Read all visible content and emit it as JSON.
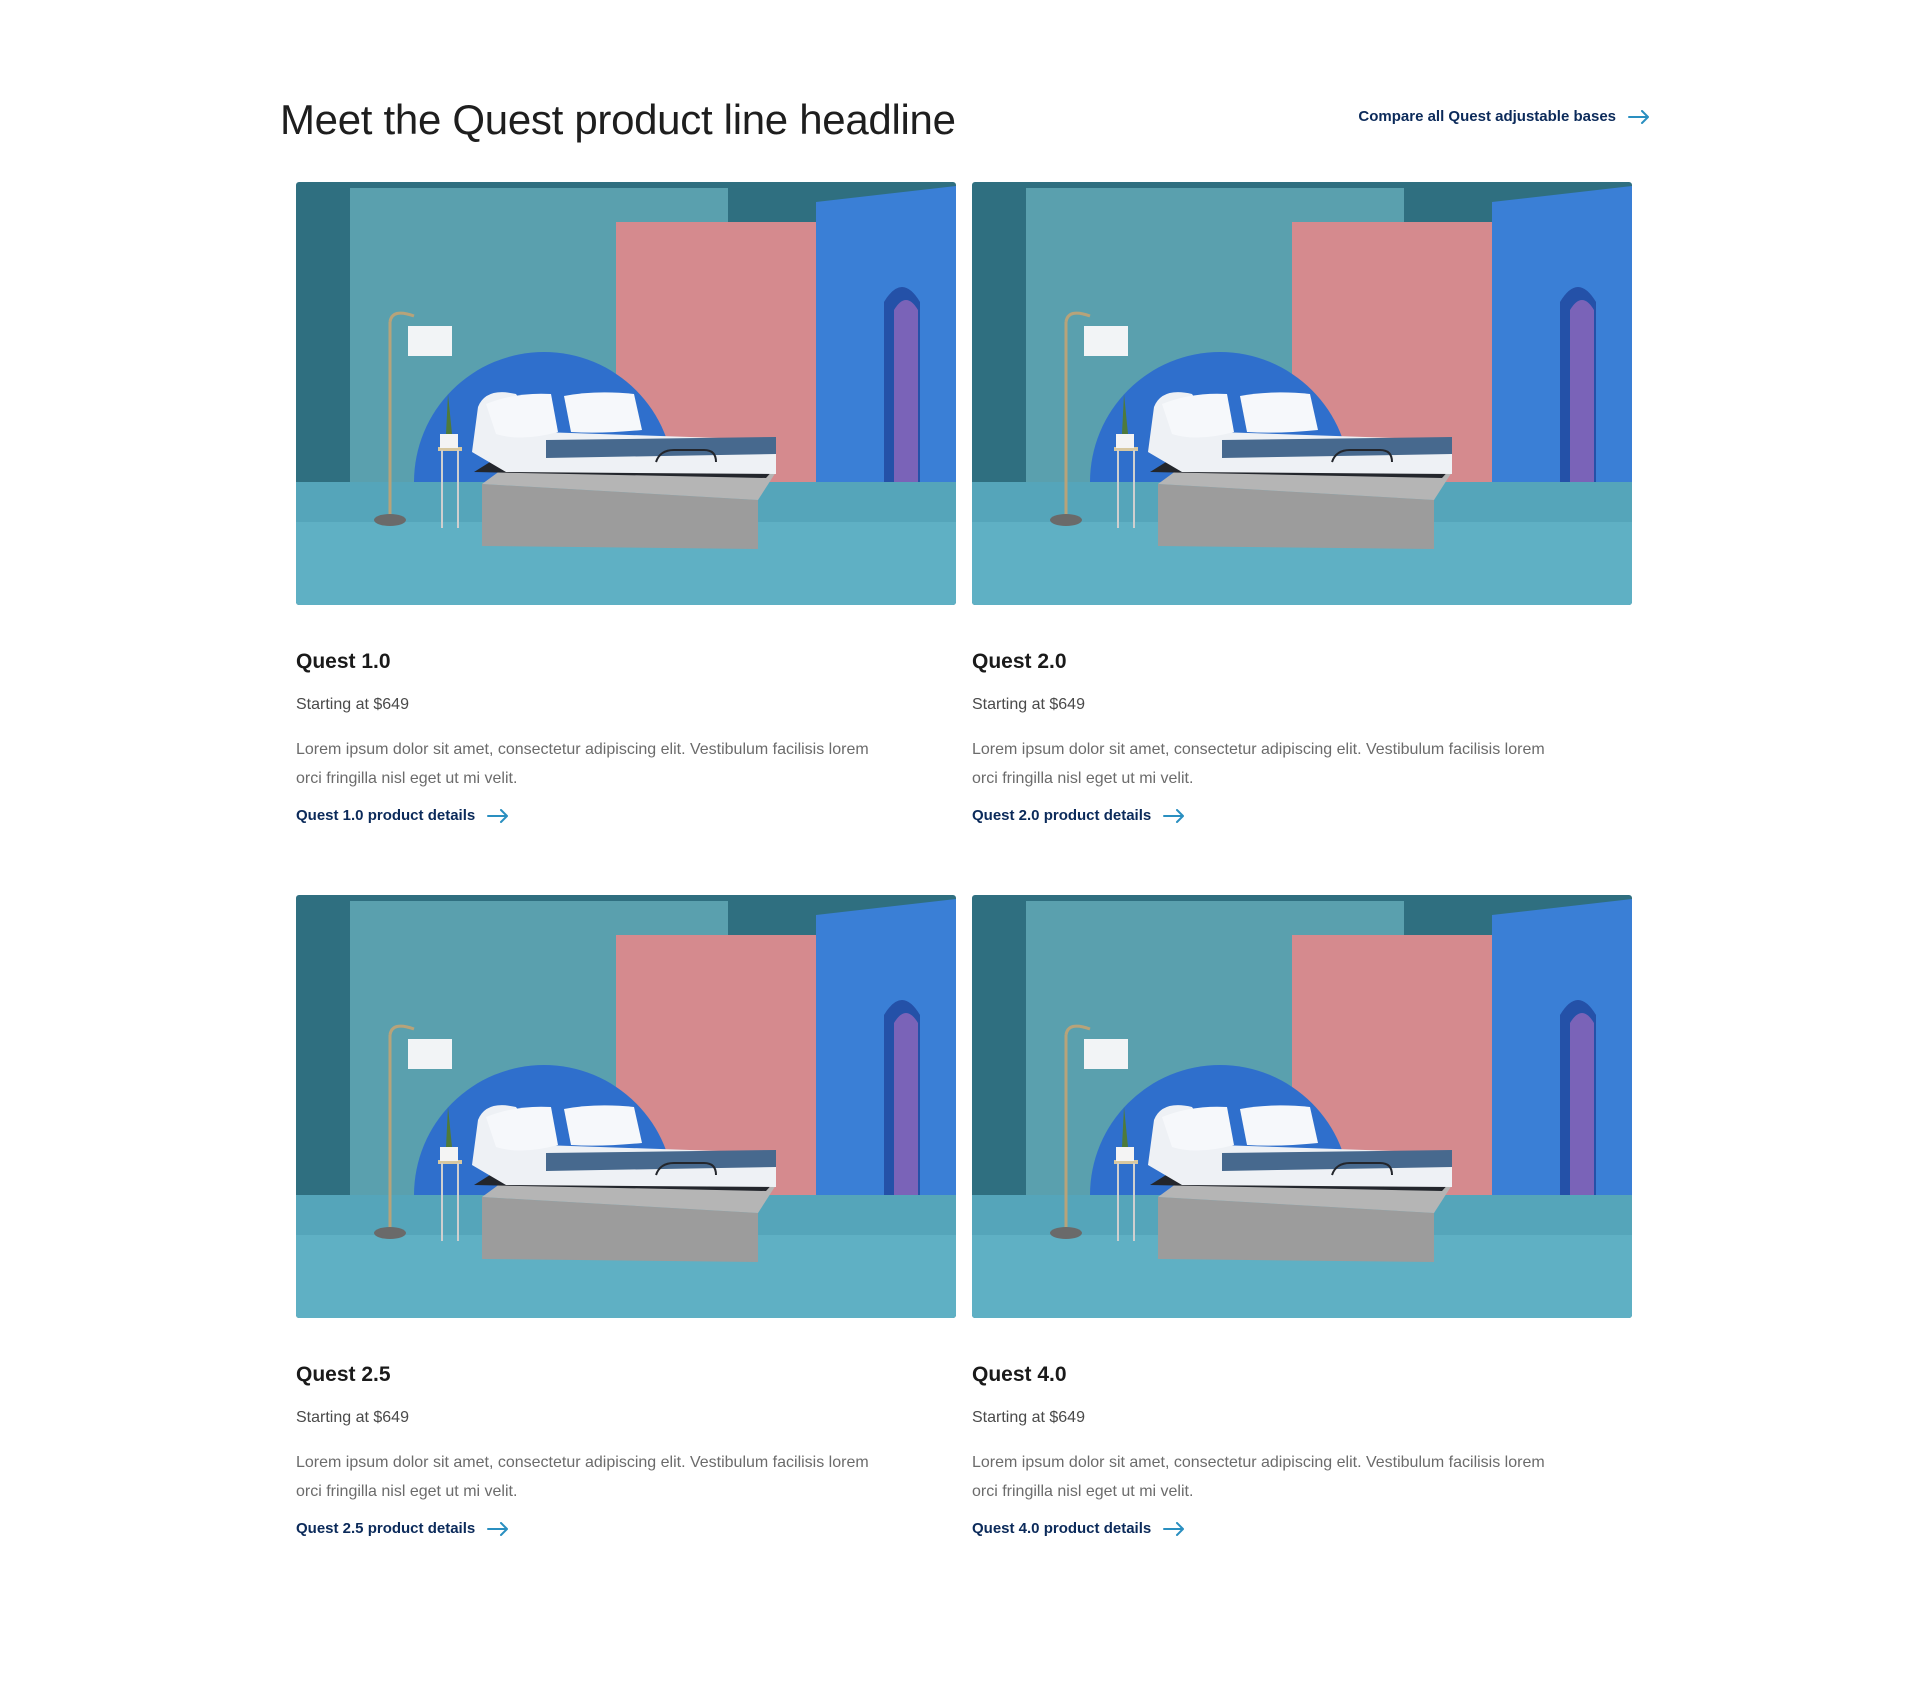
{
  "header": {
    "headline": "Meet the Quest product line headline",
    "compare_link": "Compare all Quest adjustable bases"
  },
  "colors": {
    "link": "#0b2a5a",
    "arrow": "#2a8fc0",
    "wall_teal": "#4f9aa8",
    "wall_pink": "#d58a8e",
    "wall_blue": "#3a7fd6",
    "floor": "#5fb0c4"
  },
  "products": [
    {
      "title": "Quest 1.0",
      "price": "Starting at $649",
      "description": "Lorem ipsum dolor sit amet, consectetur adipiscing elit. Vestibulum facilisis lorem orci fringilla nisl eget ut mi velit.",
      "link": "Quest 1.0 product details"
    },
    {
      "title": "Quest 2.0",
      "price": "Starting at $649",
      "description": "Lorem ipsum dolor sit amet, consectetur adipiscing elit. Vestibulum facilisis lorem orci fringilla nisl eget ut mi velit.",
      "link": "Quest 2.0 product details"
    },
    {
      "title": "Quest 2.5",
      "price": "Starting at $649",
      "description": "Lorem ipsum dolor sit amet, consectetur adipiscing elit. Vestibulum facilisis lorem orci fringilla nisl eget ut mi velit.",
      "link": "Quest 2.5 product details"
    },
    {
      "title": "Quest 4.0",
      "price": "Starting at $649",
      "description": "Lorem ipsum dolor sit amet, consectetur adipiscing elit. Vestibulum facilisis lorem orci fringilla nisl eget ut mi velit.",
      "link": "Quest 4.0 product details"
    }
  ]
}
